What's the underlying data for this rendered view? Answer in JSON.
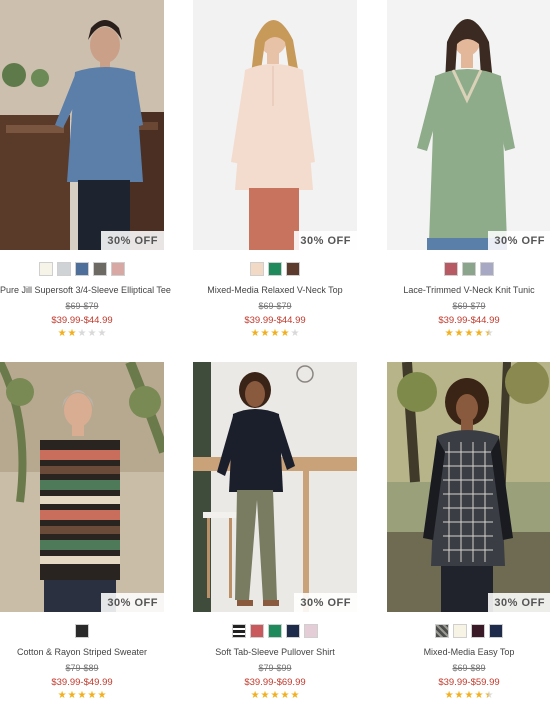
{
  "products": [
    {
      "name": "Pure Jill Supersoft 3/4-Sleeve Elliptical Tee",
      "badge": "30% OFF",
      "original_price": "$69-$79",
      "sale_price": "$39.99-$44.99",
      "swatches": [
        "#f6f4e8",
        "#cfd3d6",
        "#4d6f99",
        "#6d6a64",
        "#d8a8a4"
      ],
      "rating": 2,
      "image": "woman in blue elliptical tee"
    },
    {
      "name": "Mixed-Media Relaxed V-Neck Top",
      "badge": "30% OFF",
      "original_price": "$69-$79",
      "sale_price": "$39.99-$44.99",
      "swatches": [
        "#f1d9c6",
        "#1f8a5c",
        "#5c3a2c"
      ],
      "rating": 4,
      "image": "woman in blush v-neck top"
    },
    {
      "name": "Lace-Trimmed V-Neck Knit Tunic",
      "badge": "30% OFF",
      "original_price": "$69-$79",
      "sale_price": "$39.99-$44.99",
      "swatches": [
        "#b85a64",
        "#8aa58c",
        "#a7a9c4"
      ],
      "rating": 4.5,
      "image": "woman in green lace-trimmed tunic"
    },
    {
      "name": "Cotton & Rayon Striped Sweater",
      "badge": "30% OFF",
      "original_price": "$79-$89",
      "sale_price": "$39.99-$49.99",
      "swatches": [
        "#2a2a2a"
      ],
      "rating": 5,
      "image": "woman in striped sweater"
    },
    {
      "name": "Soft Tab-Sleeve Pullover Shirt",
      "badge": "30% OFF",
      "original_price": "$79-$99",
      "sale_price": "$39.99-$69.99",
      "swatches": [
        "#2b2b2b",
        "#c9595c",
        "#1f8a5c",
        "#1e2b4a",
        "#e4cdd6"
      ],
      "rating": 5,
      "image": "woman in black pullover shirt"
    },
    {
      "name": "Mixed-Media Easy Top",
      "badge": "30% OFF",
      "original_price": "$69-$89",
      "sale_price": "$39.99-$59.99",
      "swatches": [
        "#4b4e4a",
        "#f7f4e6",
        "#3a1a26",
        "#1e2b4a"
      ],
      "rating": 4.5,
      "image": "woman in patterned mixed-media top"
    }
  ],
  "colors": {
    "sale": "#c0392b",
    "star": "#f2b01e",
    "star_off": "#d9d9d9"
  }
}
